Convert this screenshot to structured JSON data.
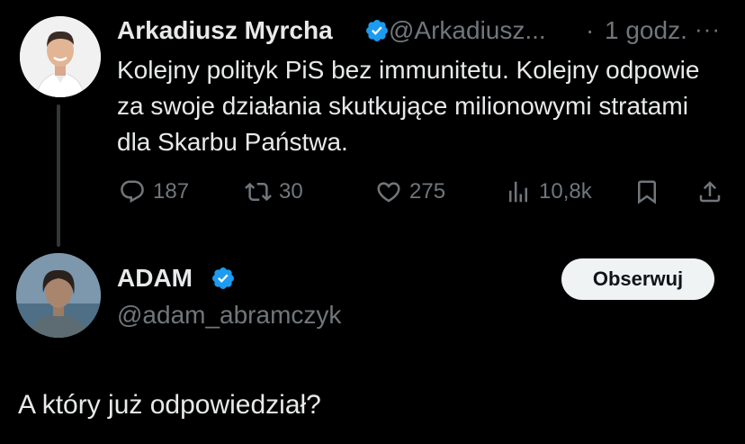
{
  "tweet": {
    "author_name": "Arkadiusz Myrcha",
    "handle": "@Arkadiusz...",
    "separator": "·",
    "time": "1 godz.",
    "more": "···",
    "text": "Kolejny polityk PiS bez immunitetu. Kolejny odpowie za swoje działania skutkujące milionowymi stratami dla Skarbu Państwa.",
    "stats": {
      "replies": "187",
      "retweets": "30",
      "likes": "275",
      "views": "10,8k"
    }
  },
  "reply": {
    "author_name": "ADAM",
    "handle": "@adam_abramczyk",
    "follow_label": "Obserwuj",
    "text": "A który już odpowiedział?"
  },
  "colors": {
    "background": "#000000",
    "text": "#e7e9ea",
    "muted": "#71767b",
    "verified": "#1d9bf0",
    "follow_button_bg": "#eff3f4"
  },
  "icons": [
    "reply-icon",
    "retweet-icon",
    "like-icon",
    "views-icon",
    "bookmark-icon",
    "share-icon",
    "verified-badge-icon"
  ]
}
